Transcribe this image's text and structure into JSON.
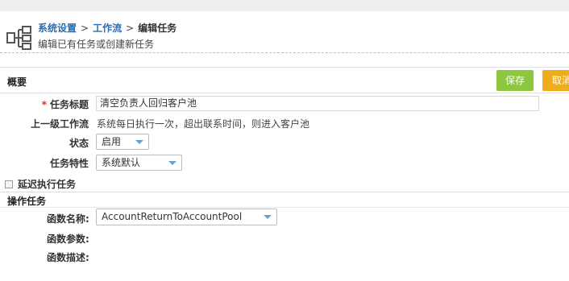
{
  "breadcrumb": {
    "item1": "系统设置",
    "sep1": ">",
    "item2": "工作流",
    "sep2": ">",
    "current": "编辑任务"
  },
  "header": {
    "subtitle": "编辑已有任务或创建新任务"
  },
  "overview": {
    "title": "概要",
    "save_label": "保存",
    "cancel_label": "取消"
  },
  "form": {
    "required_mark": "*",
    "task_title_label": "任务标题",
    "task_title_value": "清空负责人回归客户池",
    "parent_workflow_label": "上一级工作流",
    "parent_workflow_value": "系统每日执行一次，超出联系时间，则进入客户池",
    "status_label": "状态",
    "status_value": "启用",
    "feature_label": "任务特性",
    "feature_value": "系统默认",
    "delay_label": "延迟执行任务",
    "delay_checked": false
  },
  "operation": {
    "title": "操作任务",
    "function_name_label": "函数名称:",
    "function_name_value": "AccountReturnToAccountPool",
    "function_params_label": "函数参数:",
    "function_desc_label": "函数描述:"
  },
  "colors": {
    "save": "#8dc63f",
    "cancel": "#f0ad1b",
    "link": "#2a6db5",
    "required": "#d9302c"
  }
}
